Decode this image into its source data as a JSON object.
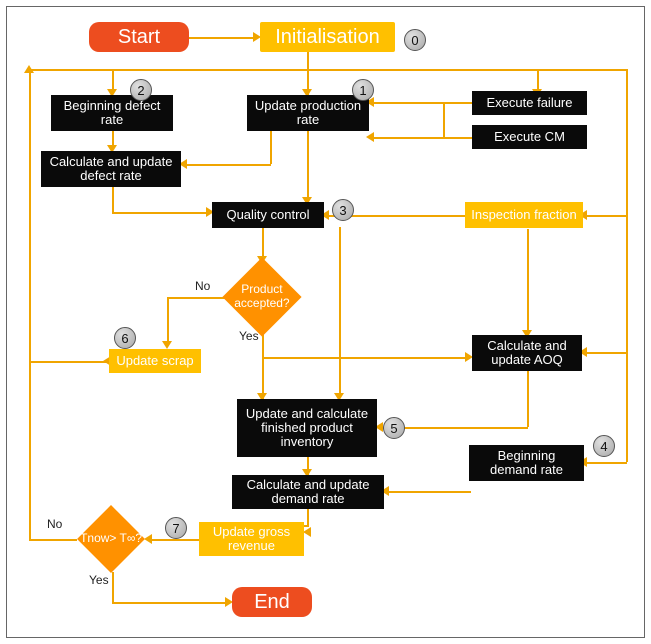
{
  "chart_data": {
    "type": "flowchart",
    "title": "",
    "nodes": {
      "start": "Start",
      "init": "Initialisation",
      "upd_prod": "Update production rate",
      "begin_defect": "Beginning defect rate",
      "calc_defect": "Calculate and update defect rate",
      "exec_fail": "Execute failure",
      "exec_cm": "Execute CM",
      "quality": "Quality control",
      "insp_frac": "Inspection fraction",
      "decision_accept": "Product\naccepted?",
      "update_scrap": "Update scrap",
      "calc_aoq": "Calculate and update AOQ",
      "upd_inv": "Update and calculate finished product inventory",
      "begin_demand": "Beginning demand rate",
      "calc_demand": "Calculate and update demand rate",
      "upd_gross": "Update gross revenue",
      "decision_time": "Tnow> T∞?",
      "end": "End"
    },
    "badges": {
      "b0": "0",
      "b1": "1",
      "b2": "2",
      "b3": "3",
      "b4": "4",
      "b5": "5",
      "b6": "6",
      "b7": "7"
    },
    "edge_labels": {
      "accept_yes": "Yes",
      "accept_no": "No",
      "time_yes": "Yes",
      "time_no": "No"
    },
    "edges": [
      [
        "start",
        "init"
      ],
      [
        "init",
        "upd_prod"
      ],
      [
        "init",
        "begin_defect"
      ],
      [
        "init",
        "exec_fail"
      ],
      [
        "init",
        "insp_frac"
      ],
      [
        "init",
        "begin_demand"
      ],
      [
        "begin_defect",
        "calc_defect"
      ],
      [
        "upd_prod",
        "calc_defect"
      ],
      [
        "exec_fail",
        "upd_prod"
      ],
      [
        "exec_cm",
        "upd_prod"
      ],
      [
        "calc_defect",
        "quality"
      ],
      [
        "insp_frac",
        "quality"
      ],
      [
        "quality",
        "decision_accept"
      ],
      [
        "decision_accept",
        "update_scrap",
        "No"
      ],
      [
        "decision_accept",
        "upd_inv",
        "Yes"
      ],
      [
        "decision_accept",
        "calc_aoq",
        "Yes"
      ],
      [
        "insp_frac",
        "calc_aoq"
      ],
      [
        "calc_aoq",
        "upd_inv"
      ],
      [
        "upd_inv",
        "calc_demand"
      ],
      [
        "begin_demand",
        "calc_demand"
      ],
      [
        "calc_demand",
        "upd_gross"
      ],
      [
        "upd_gross",
        "decision_time"
      ],
      [
        "decision_time",
        "end",
        "Yes"
      ],
      [
        "decision_time",
        "loop_to_top",
        "No"
      ]
    ]
  }
}
